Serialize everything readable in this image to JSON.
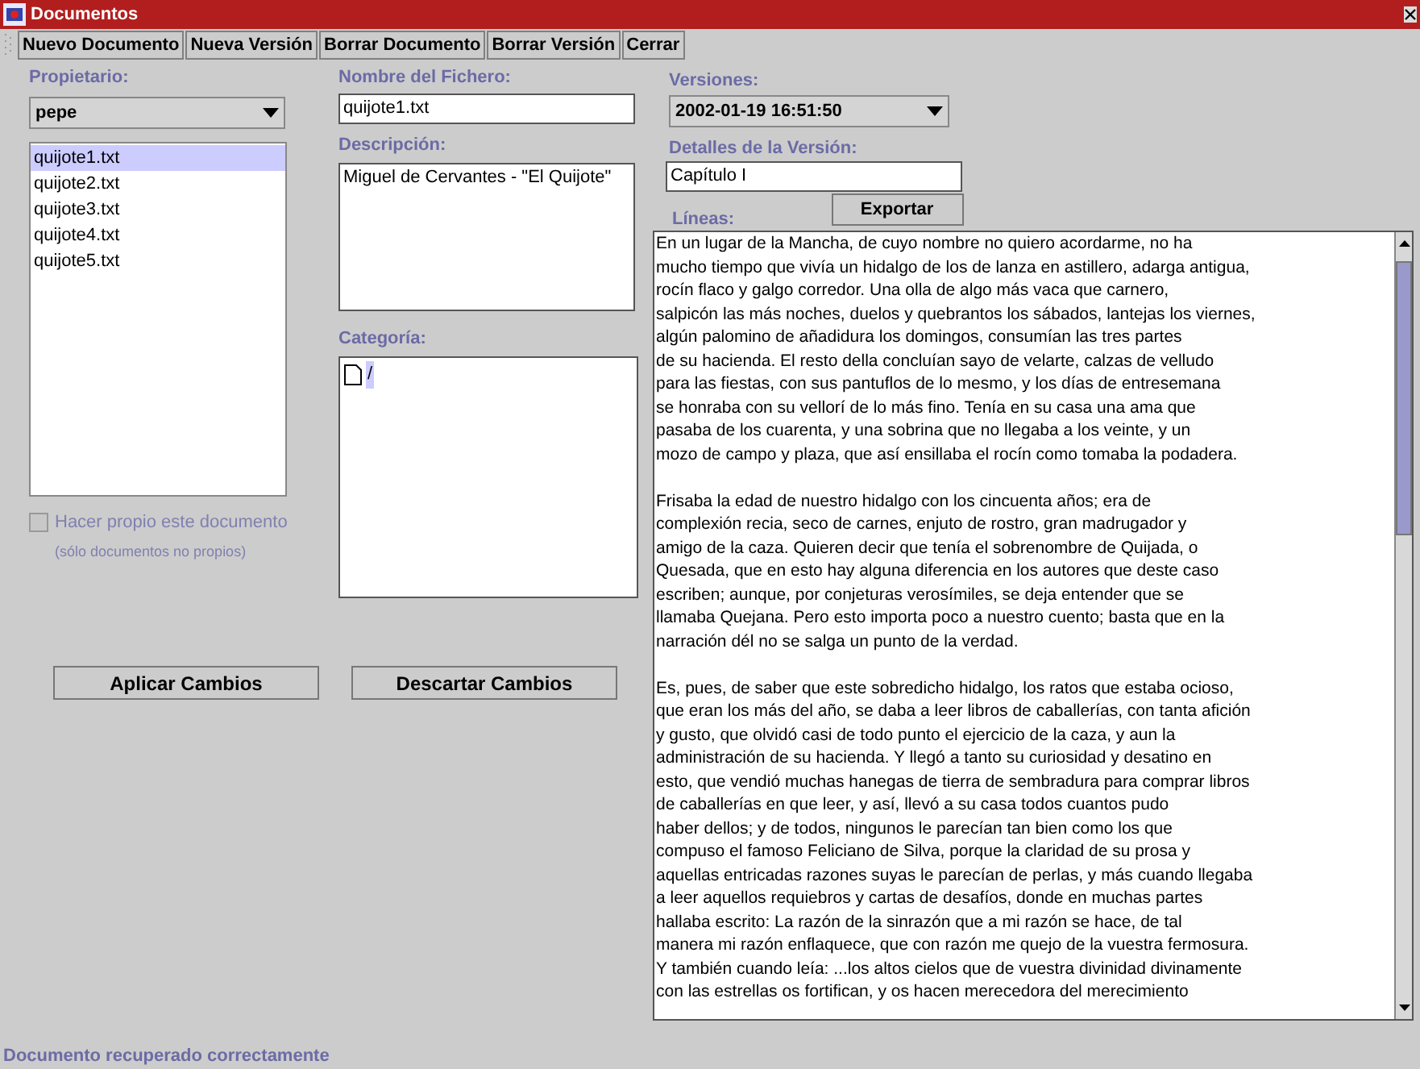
{
  "window": {
    "title": "Documentos"
  },
  "toolbar": [
    "Nuevo Documento",
    "Nueva Versión",
    "Borrar Documento",
    "Borrar Versión",
    "Cerrar"
  ],
  "owner": {
    "label": "Propietario:",
    "value": "pepe"
  },
  "files": [
    {
      "name": "quijote1.txt",
      "selected": true
    },
    {
      "name": "quijote2.txt",
      "selected": false
    },
    {
      "name": "quijote3.txt",
      "selected": false
    },
    {
      "name": "quijote4.txt",
      "selected": false
    },
    {
      "name": "quijote5.txt",
      "selected": false
    }
  ],
  "own_checkbox": {
    "label": "Hacer propio este documento",
    "hint": "(sólo documentos no propios)",
    "checked": false,
    "disabled": true
  },
  "file_name": {
    "label": "Nombre del Fichero:",
    "value": "quijote1.txt"
  },
  "description": {
    "label": "Descripción:",
    "value": "Miguel de Cervantes - \"El Quijote\""
  },
  "category": {
    "label": "Categoría:",
    "items": [
      {
        "name": "/",
        "selected": true
      }
    ]
  },
  "versions": {
    "label": "Versiones:",
    "value": "2002-01-19 16:51:50"
  },
  "version_details": {
    "label": "Detalles de la Versión:",
    "value": "Capítulo I"
  },
  "export_button": "Exportar",
  "lines": {
    "label": "Líneas:",
    "paragraphs": [
      [
        "En un lugar de la Mancha, de cuyo nombre no quiero acordarme, no ha",
        "mucho tiempo que vivía un hidalgo de los de lanza en astillero, adarga antigua,",
        "rocín flaco y galgo corredor. Una olla de algo más vaca que carnero,",
        "salpicón las más noches, duelos y quebrantos los sábados, lantejas los viernes,",
        "algún palomino de añadidura los domingos, consumían las tres partes",
        "de su hacienda. El resto della concluían sayo de velarte, calzas de velludo",
        "para las fiestas, con sus pantuflos de lo mesmo, y los días de entresemana",
        "se honraba con su vellorí de lo más fino. Tenía en su casa una ama que",
        "pasaba de los cuarenta, y una sobrina que no llegaba a los veinte, y un",
        "mozo de campo y plaza, que así ensillaba el rocín como tomaba la podadera."
      ],
      [
        "Frisaba la edad de nuestro hidalgo con los cincuenta años; era de",
        "complexión recia, seco de carnes, enjuto de rostro, gran madrugador y",
        "amigo de la caza. Quieren decir que tenía el sobrenombre de Quijada, o",
        "Quesada, que en esto hay alguna diferencia en los autores que deste caso",
        "escriben; aunque, por conjeturas verosímiles, se deja entender que se",
        "llamaba Quejana. Pero esto importa poco a nuestro cuento; basta que en la",
        "narración dél no se salga un punto de la verdad."
      ],
      [
        "Es, pues, de saber que este sobredicho hidalgo, los ratos que estaba ocioso,",
        "que eran los más del año, se daba a leer libros de caballerías, con tanta afición",
        "y gusto, que olvidó casi de todo punto el ejercicio de la caza, y aun la",
        "administración de su hacienda. Y llegó a tanto su curiosidad y desatino en",
        "esto, que vendió muchas hanegas de tierra de sembradura para comprar libros",
        "de caballerías en que leer, y así, llevó a su casa todos cuantos pudo",
        "haber dellos; y de todos, ningunos le parecían tan bien como los que",
        "compuso el famoso Feliciano de Silva, porque la claridad de su prosa y",
        "aquellas entricadas razones suyas le parecían de perlas, y más cuando llegaba",
        "a leer aquellos requiebros y cartas de desafíos, donde en muchas partes",
        "hallaba escrito: La razón de la sinrazón que a mi razón se hace, de tal",
        "manera mi razón enflaquece, que con razón me quejo de la vuestra fermosura.",
        "Y también cuando leía: ...los altos cielos que de vuestra divinidad divinamente",
        "con las estrellas os fortifican, y os hacen merecedora del merecimiento"
      ]
    ]
  },
  "actions": [
    "Aplicar Cambios",
    "Descartar Cambios"
  ],
  "status_bar": "Documento recuperado correctamente"
}
